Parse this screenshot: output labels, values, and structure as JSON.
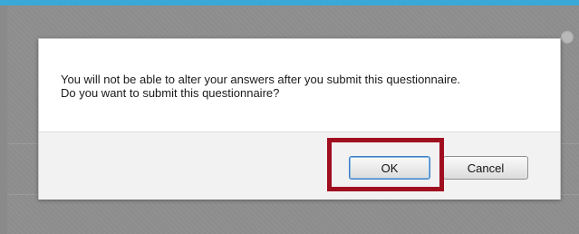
{
  "dialog": {
    "message_line1": "You will not be able to alter your answers after you submit this questionnaire.",
    "message_line2": "Do you want to submit this questionnaire?",
    "ok_label": "OK",
    "cancel_label": "Cancel"
  },
  "colors": {
    "highlight": "#a00f1f",
    "top_bar": "#3aa8d8",
    "overlay": "#8d8d8d"
  }
}
